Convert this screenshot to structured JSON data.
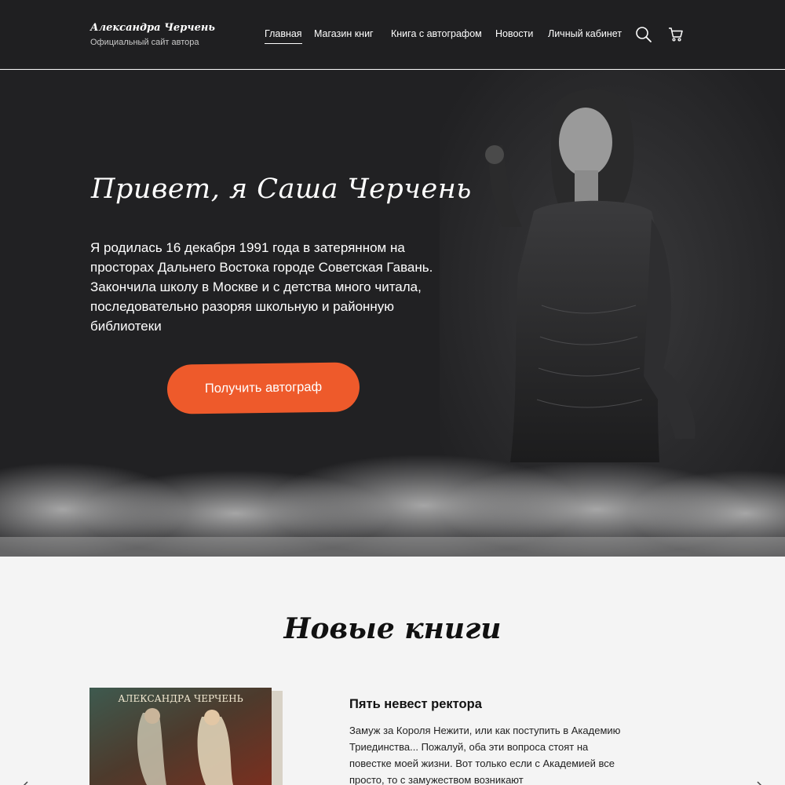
{
  "header": {
    "brand_name": "Александра Черчень",
    "brand_subtitle": "Официальный сайт автора",
    "nav": [
      {
        "label": "Главная",
        "active": true
      },
      {
        "label": "Магазин книг",
        "active": false
      },
      {
        "label": "Книга с автографом",
        "active": false
      },
      {
        "label": "Новости",
        "active": false
      },
      {
        "label": "Личный кабинет",
        "active": false
      }
    ],
    "icons": [
      "search-icon",
      "cart-icon"
    ]
  },
  "hero": {
    "title": "Привет, я Саша Черчень",
    "text": "Я родилась 16 декабря 1991 года в затерянном на просторах Дальнего Востока городе Советская Гавань. Закончила школу в Москве и с детства много читала, последовательно разоряя школьную и районную библиотеки",
    "cta_label": "Получить автограф"
  },
  "new_books": {
    "title": "Новые книги",
    "book": {
      "cover_author": "АЛЕКСАНДРА ЧЕРЧЕНЬ",
      "title": "Пять невест ректора",
      "description": "Замуж за Короля Нежити, или как поступить в Академию Триединства... Пожалуй, оба эти вопроса стоят на повестке моей жизни. Вот только если с Академией все просто, то с замужеством возникают"
    }
  },
  "colors": {
    "header_bg": "#1f1f21",
    "hero_bg": "#212123",
    "accent": "#ee5a2b",
    "page_bg": "#f4f4f4"
  }
}
